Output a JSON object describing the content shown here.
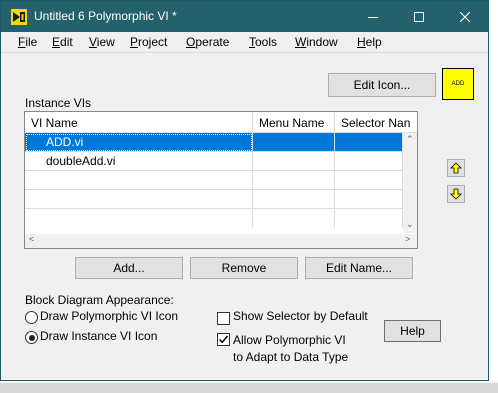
{
  "window": {
    "title": "Untitled 6 Polymorphic VI *",
    "controls": {
      "minimize": "minimize",
      "maximize": "maximize",
      "close": "close"
    }
  },
  "menu": {
    "items": [
      {
        "u": "F",
        "rest": "ile"
      },
      {
        "u": "E",
        "rest": "dit"
      },
      {
        "u": "V",
        "rest": "iew"
      },
      {
        "u": "P",
        "rest": "roject"
      },
      {
        "u": "O",
        "rest": "perate"
      },
      {
        "u": "T",
        "rest": "ools"
      },
      {
        "u": "W",
        "rest": "indow"
      },
      {
        "u": "H",
        "rest": "elp"
      }
    ]
  },
  "edit_icon": {
    "label": "Edit Icon...",
    "icon_text": "ADD",
    "icon_color": "#ffff00"
  },
  "instances": {
    "label": "Instance VIs",
    "columns": [
      "VI Name",
      "Menu Name",
      "Selector Nan"
    ],
    "rows": [
      [
        "ADD.vi",
        "",
        ""
      ],
      [
        "doubleAdd.vi",
        "",
        ""
      ]
    ],
    "selected_index": 0
  },
  "buttons": {
    "add": "Add...",
    "remove": "Remove",
    "edit_name": "Edit Name...",
    "help": "Help"
  },
  "appearance": {
    "label": "Block Diagram Appearance:",
    "option_polymorphic": "Draw Polymorphic VI Icon",
    "option_instance": "Draw Instance VI Icon",
    "selected": "instance"
  },
  "options": {
    "show_selector": {
      "label": "Show Selector by Default",
      "checked": false
    },
    "allow_adapt": {
      "label_line1": "Allow Polymorphic VI",
      "label_line2": "to Adapt to Data Type",
      "checked": true
    }
  },
  "colors": {
    "titlebar": "#24616c",
    "selection": "#0078d7",
    "window_bg": "#f0f0f0",
    "arrow_icon": "#ffff00"
  }
}
